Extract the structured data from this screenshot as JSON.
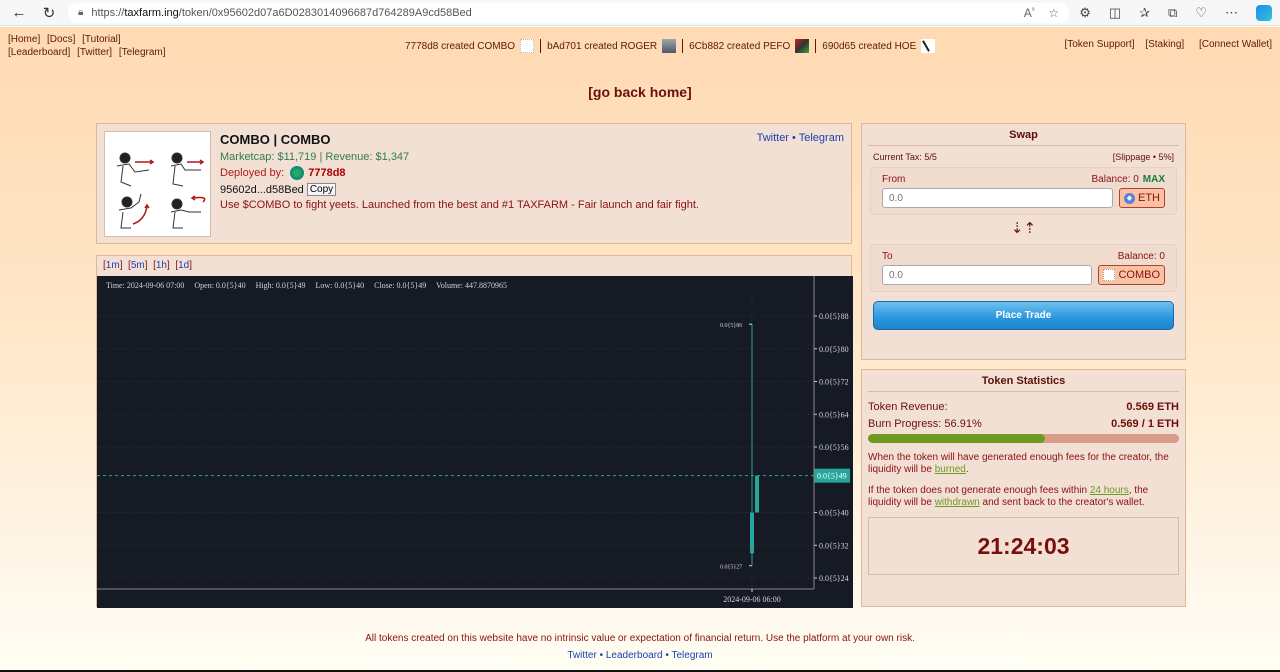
{
  "browser": {
    "url_prefix": "https://",
    "url_domain": "taxfarm.ing",
    "url_path": "/token/0x95602d07a6D0283014096687d764289A9cd58Bed"
  },
  "nav": {
    "left_row1": [
      "[Home]",
      "[Docs]",
      "[Tutorial]"
    ],
    "left_row2": [
      "[Leaderboard]",
      "[Twitter]",
      "[Telegram]"
    ],
    "right": [
      "[Token Support]",
      "[Staking]",
      "[Connect Wallet]"
    ]
  },
  "ticker": [
    {
      "text": "7778d8 created COMBO",
      "thumb": "combo"
    },
    {
      "text": "bAd701 created ROGER",
      "thumb": "roger"
    },
    {
      "text": "6Cb882 created PEFO",
      "thumb": "pefo"
    },
    {
      "text": "690d65 created HOE",
      "thumb": "hoe"
    }
  ],
  "go_home": "[go back home]",
  "token": {
    "title": "COMBO | COMBO",
    "marketcap_revenue": "Marketcap: $11,719 | Revenue: $1,347",
    "deployed_label": "Deployed by:",
    "deployer": "7778d8",
    "address_short": "95602d...d58Bed",
    "copy_label": "Copy",
    "description": "Use $COMBO to fight yeets. Launched from the best and #1 TAXFARM - Fair launch and fair fight.",
    "link_twitter": "Twitter",
    "link_sep": " • ",
    "link_telegram": "Telegram"
  },
  "timeframes": [
    "1m",
    "5m",
    "1h",
    "1d"
  ],
  "chart_data": {
    "type": "candlestick",
    "legend": {
      "time": "Time: 2024-09-06 07:00",
      "open": "Open: 0.0{5}40",
      "high": "High: 0.0{5}49",
      "low": "Low: 0.0{5}40",
      "close": "Close: 0.0{5}49",
      "volume": "Volume: 447.8870965"
    },
    "y_unit_note": "prices in units of 1e-7 (0.0{5}XX = 0.00000XX)",
    "ylim": [
      22,
      90
    ],
    "y_ticks": [
      88,
      80,
      72,
      64,
      56,
      49,
      40,
      32,
      24
    ],
    "y_tick_labels": [
      "0.0{5}88",
      "0.0{5}80",
      "0.0{5}72",
      "0.0{5}64",
      "0.0{5}56",
      "0.0{5}49",
      "0.0{5}40",
      "0.0{5}32",
      "0.0{5}24"
    ],
    "last_price": 49,
    "last_price_label": "0.0{5}49",
    "x_tick_label": "2024-09-06 06:00",
    "candles": [
      {
        "time": "2024-09-06 06:00",
        "open": 30,
        "high": 86,
        "low": 27,
        "close": 40
      },
      {
        "time": "2024-09-06 07:00",
        "open": 40,
        "high": 49,
        "low": 40,
        "close": 49
      }
    ],
    "high_marker": "0.0{5}86",
    "low_marker": "0.0{5}27",
    "colors": {
      "up": "#26a69a",
      "bg": "#161a25",
      "grid": "#2a2e39",
      "text": "#d1d4dc",
      "last_price_bg": "#26a69a"
    }
  },
  "swap": {
    "title": "Swap",
    "current_tax": "Current Tax: 5/5",
    "slippage": "[Slippage • 5%]",
    "from_label": "From",
    "from_balance": "Balance: 0",
    "max_label": "MAX",
    "from_placeholder": "0.0",
    "from_token": "ETH",
    "arrows": "⇣⇡",
    "to_label": "To",
    "to_balance": "Balance: 0",
    "to_placeholder": "0.0",
    "to_token": "COMBO",
    "place_trade": "Place Trade"
  },
  "stats": {
    "title": "Token Statistics",
    "revenue_label": "Token Revenue:",
    "revenue_value": "0.569 ETH",
    "burn_label": "Burn Progress: 56.91%",
    "burn_value": "0.569 / 1 ETH",
    "burn_progress": 0.5691,
    "note1_pre": "When the token will have generated enough fees for the creator, the liquidity will be ",
    "note1_link": "burned",
    "note1_post": ".",
    "note2_pre": "If the token does not generate enough fees within ",
    "note2_link1": "24 hours",
    "note2_mid": ", the liquidity will be ",
    "note2_link2": "withdrawn",
    "note2_post": " and sent back to the creator's wallet.",
    "countdown": "21:24:03"
  },
  "footer": {
    "disclaimer": "All tokens created on this website have no intrinsic value or expectation of financial return. Use the platform at your own risk.",
    "links": [
      "Twitter",
      "Leaderboard",
      "Telegram"
    ],
    "sep": " • "
  }
}
